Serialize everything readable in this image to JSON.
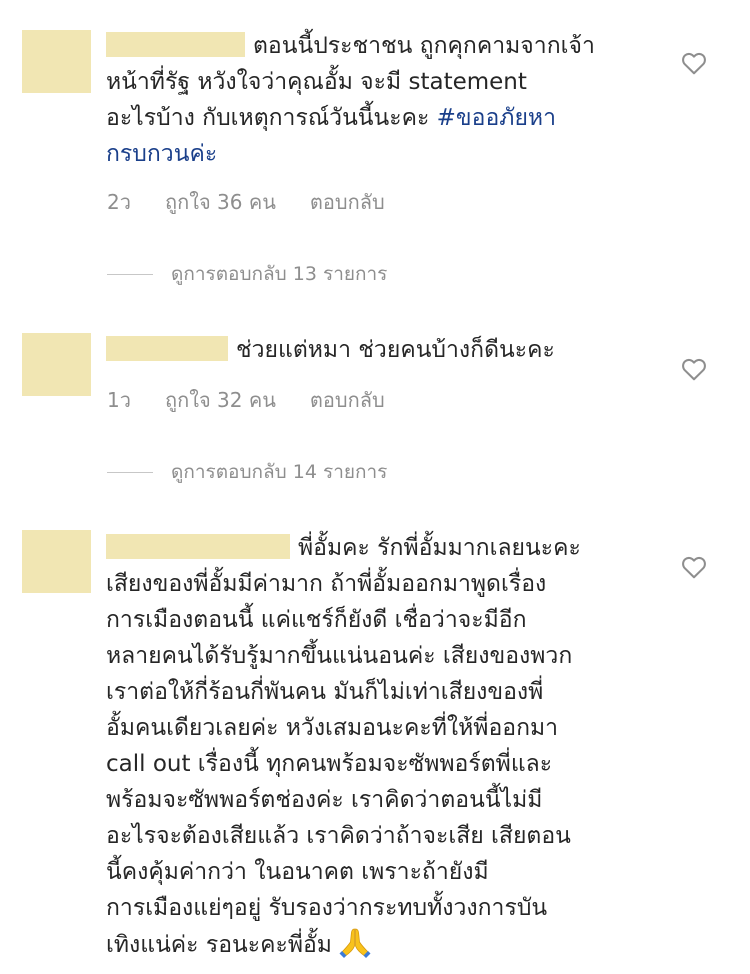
{
  "colors": {
    "mask": "#f1e6b3",
    "text": "#262626",
    "meta": "#8e8e8e",
    "hashtag": "#1a3f8a"
  },
  "icons": {
    "like": "heart-outline-icon",
    "emoji": "folded-hands-emoji"
  },
  "comments": [
    {
      "text_lines": [
        "ตอนนี้ประชาชน ถูกคุกคามจากเจ้า",
        "หน้าที่รัฐ หวังใจว่าคุณอั้ม จะมี statement",
        "อะไรบ้าง กับเหตุการณ์วันนี้นะคะ "
      ],
      "hashtag_part1": "#ขออภัยหา",
      "hashtag_part2": "กรบกวนค่ะ",
      "time": "2ว",
      "likes": "ถูกใจ 36 คน",
      "reply": "ตอบกลับ",
      "view_replies": "ดูการตอบกลับ 13 รายการ"
    },
    {
      "text_lines": [
        "ช่วยแต่หมา ช่วยคนบ้างก็ดีนะคะ"
      ],
      "time": "1ว",
      "likes": "ถูกใจ 32 คน",
      "reply": "ตอบกลับ",
      "view_replies": "ดูการตอบกลับ 14 รายการ"
    },
    {
      "text_lines": [
        "พี่อั้มคะ รักพี่อั้มมากเลยนะคะ",
        "เสียงของพี่อั้มมีค่ามาก ถ้าพี่อั้มออกมาพูดเรื่อง",
        "การเมืองตอนนี้ แค่แชร์ก็ยังดี เชื่อว่าจะมีอีก",
        "หลายคนได้รับรู้มากขึ้นแน่นอนค่ะ เสียงของพวก",
        "เราต่อให้กี่ร้อนกี่พันคน มันก็ไม่เท่าเสียงของพี่",
        "อั้มคนเดียวเลยค่ะ หวังเสมอนะคะที่ให้พี่ออกมา",
        "call out เรื่องนี้ ทุกคนพร้อมจะซัพพอร์ตพี่และ",
        "พร้อมจะซัพพอร์ตช่องค่ะ เราคิดว่าตอนนี้ไม่มี",
        "อะไรจะต้องเสียแล้ว เราคิดว่าถ้าจะเสีย เสียตอน",
        "นี้คงคุ้มค่ากว่า ในอนาคต เพราะถ้ายังมี",
        "การเมืองแย่ๆอยู่ รับรองว่ากระทบทั้งวงการบัน",
        "เทิงแน่ค่ะ รอนะคะพี่อั้ม"
      ]
    }
  ]
}
